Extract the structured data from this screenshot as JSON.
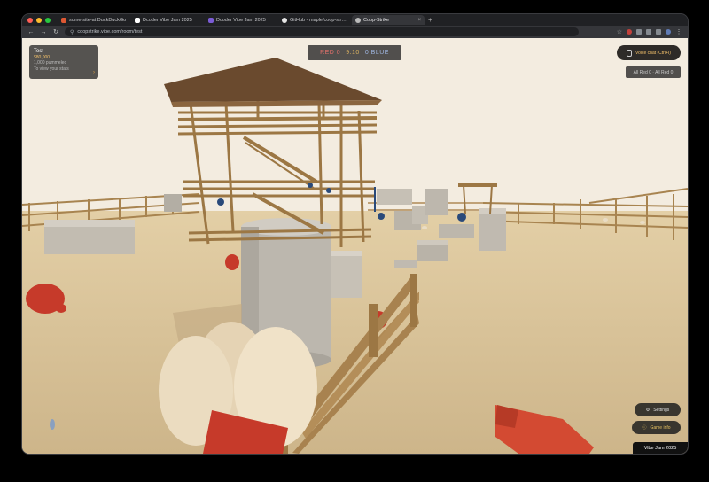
{
  "browser": {
    "tabs": [
      {
        "title": "some-site-at DuckDuckGo",
        "active": false
      },
      {
        "title": "Dcoder Vibe Jam 2025",
        "active": false
      },
      {
        "title": "Dcoder Vibe Jam 2025",
        "active": false
      },
      {
        "title": "GitHub - maple/coop-strike",
        "active": false
      },
      {
        "title": "Coop-Strike",
        "active": true
      }
    ],
    "new_tab_icon": "plus-icon",
    "url": "coopstrike.vibe.com/room/test"
  },
  "hud": {
    "player": {
      "name": "Test",
      "balance": "$80,000",
      "line2": "1,000 pummeled",
      "line3": "To view your stats",
      "arrow": "›"
    },
    "score": {
      "red_label": "RED 0",
      "center": "9:10",
      "blue_label": "0 BLUE"
    },
    "voice_chat": "Voice chat (Ctrl+I)",
    "team_count": "All Red 0 · All Red 0",
    "settings": "Settings",
    "game_info": "Game info",
    "vibe_badge": "Vibe Jam 2025"
  },
  "colors": {
    "sky": "#f3ece0",
    "ground": "#d8c49c",
    "wood": "#b08a55",
    "roof": "#6a4a2e",
    "red_chicken": "#c63a2a",
    "blue_chicken": "#2a4a7a",
    "egg": "#efe0c4",
    "concrete": "#b8b2a8"
  }
}
